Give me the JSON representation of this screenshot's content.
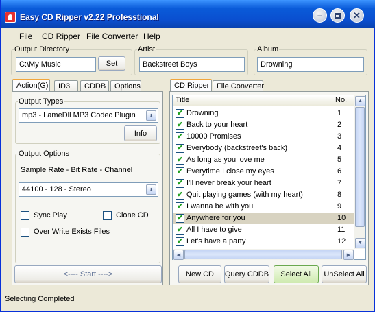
{
  "window": {
    "title": "Easy CD Ripper v2.22 Professtional"
  },
  "menu": [
    "File",
    "CD Ripper",
    "File Converter",
    "Help"
  ],
  "output_directory": {
    "label": "Output Directory",
    "value": "C:\\My Music",
    "set_label": "Set"
  },
  "artist": {
    "label": "Artist",
    "value": "Backstreet Boys"
  },
  "album": {
    "label": "Album",
    "value": "Drowning"
  },
  "left_tabs": [
    "Action(G)",
    "ID3",
    "CDDB",
    "Options"
  ],
  "right_tabs": [
    "CD Ripper",
    "File Converter"
  ],
  "output_types": {
    "label": "Output Types",
    "selected": "mp3 - LameDll MP3 Codec Plugin",
    "info_label": "Info"
  },
  "output_options": {
    "label": "Output Options",
    "sample_caption": "Sample Rate - Bit Rate - Channel",
    "sample_selected": "44100 - 128 - Stereo",
    "sync_play": "Sync Play",
    "clone_cd": "Clone CD",
    "overwrite": "Over Write Exists Files"
  },
  "start_label": "<---- Start ---->",
  "tracks": {
    "headers": [
      "Title",
      "No."
    ],
    "rows": [
      {
        "title": "Drowning",
        "no": "1"
      },
      {
        "title": "Back to your heart",
        "no": "2"
      },
      {
        "title": "10000 Promises",
        "no": "3"
      },
      {
        "title": "Everybody (backstreet's back)",
        "no": "4"
      },
      {
        "title": "As long as you love me",
        "no": "5"
      },
      {
        "title": "Everytime I close my eyes",
        "no": "6"
      },
      {
        "title": "I'll never break your heart",
        "no": "7"
      },
      {
        "title": "Quit playing games (with my heart)",
        "no": "8"
      },
      {
        "title": "I wanna be with you",
        "no": "9"
      },
      {
        "title": "Anywhere for you",
        "no": "10"
      },
      {
        "title": "All I have to give",
        "no": "11"
      },
      {
        "title": "Let's have a party",
        "no": "12"
      }
    ],
    "selected_index": 9
  },
  "bottom_buttons": {
    "new_cd": "New CD",
    "query_cddb": "Query CDDB",
    "select_all": "Select All",
    "unselect_all": "UnSelect All"
  },
  "status": "Selecting Completed"
}
